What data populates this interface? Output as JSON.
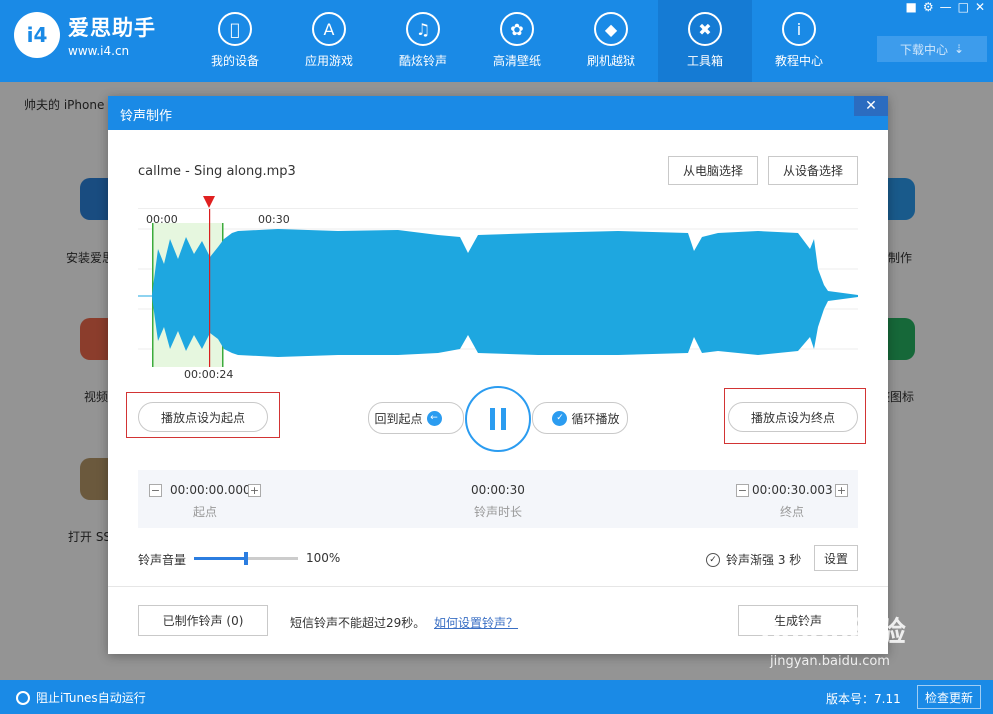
{
  "app": {
    "name": "爱思助手",
    "url": "www.i4.cn",
    "logo_text": "i4"
  },
  "nav": [
    {
      "label": "我的设备",
      "icon": "apple-icon"
    },
    {
      "label": "应用游戏",
      "icon": "appstore-icon"
    },
    {
      "label": "酷炫铃声",
      "icon": "bell-icon"
    },
    {
      "label": "高清壁纸",
      "icon": "flower-icon"
    },
    {
      "label": "刷机越狱",
      "icon": "dropbox-icon"
    },
    {
      "label": "工具箱",
      "icon": "tools-icon",
      "active": true
    },
    {
      "label": "教程中心",
      "icon": "info-icon"
    }
  ],
  "download_center": "下载中心",
  "device_label": "帅夫的 iPhone",
  "background_tools": [
    {
      "label": "安装爱思"
    },
    {
      "label": "视频"
    },
    {
      "label": "打开 SS"
    },
    {
      "label": "制作"
    },
    {
      "label": "整图标"
    }
  ],
  "dialog": {
    "title": "铃声制作",
    "filename": "callme - Sing along.mp3",
    "btn_from_pc": "从电脑选择",
    "btn_from_device": "从设备选择",
    "waveform": {
      "time_start": "00:00",
      "time_end": "00:30",
      "playhead_time": "00:00:24"
    },
    "btn_set_start": "播放点设为起点",
    "btn_back_start": "回到起点",
    "btn_loop": "循环播放",
    "btn_set_end": "播放点设为终点",
    "start": {
      "value": "00:00:00.000",
      "label": "起点"
    },
    "duration": {
      "value": "00:00:30",
      "label": "铃声时长"
    },
    "end": {
      "value": "00:00:30.003",
      "label": "终点"
    },
    "volume_label": "铃声音量",
    "volume_value": "100%",
    "volume_fraction": 0.5,
    "fade_label": "铃声渐强 3 秒",
    "btn_settings": "设置",
    "btn_made": "已制作铃声 (0)",
    "note": "短信铃声不能超过29秒。",
    "help_link": "如何设置铃声？",
    "btn_generate": "生成铃声"
  },
  "status": {
    "itunes": "阻止iTunes自动运行",
    "version": "版本号：7.11",
    "update": "检查更新"
  },
  "watermark": {
    "logo": "Baidu经验",
    "url": "jingyan.baidu.com"
  }
}
